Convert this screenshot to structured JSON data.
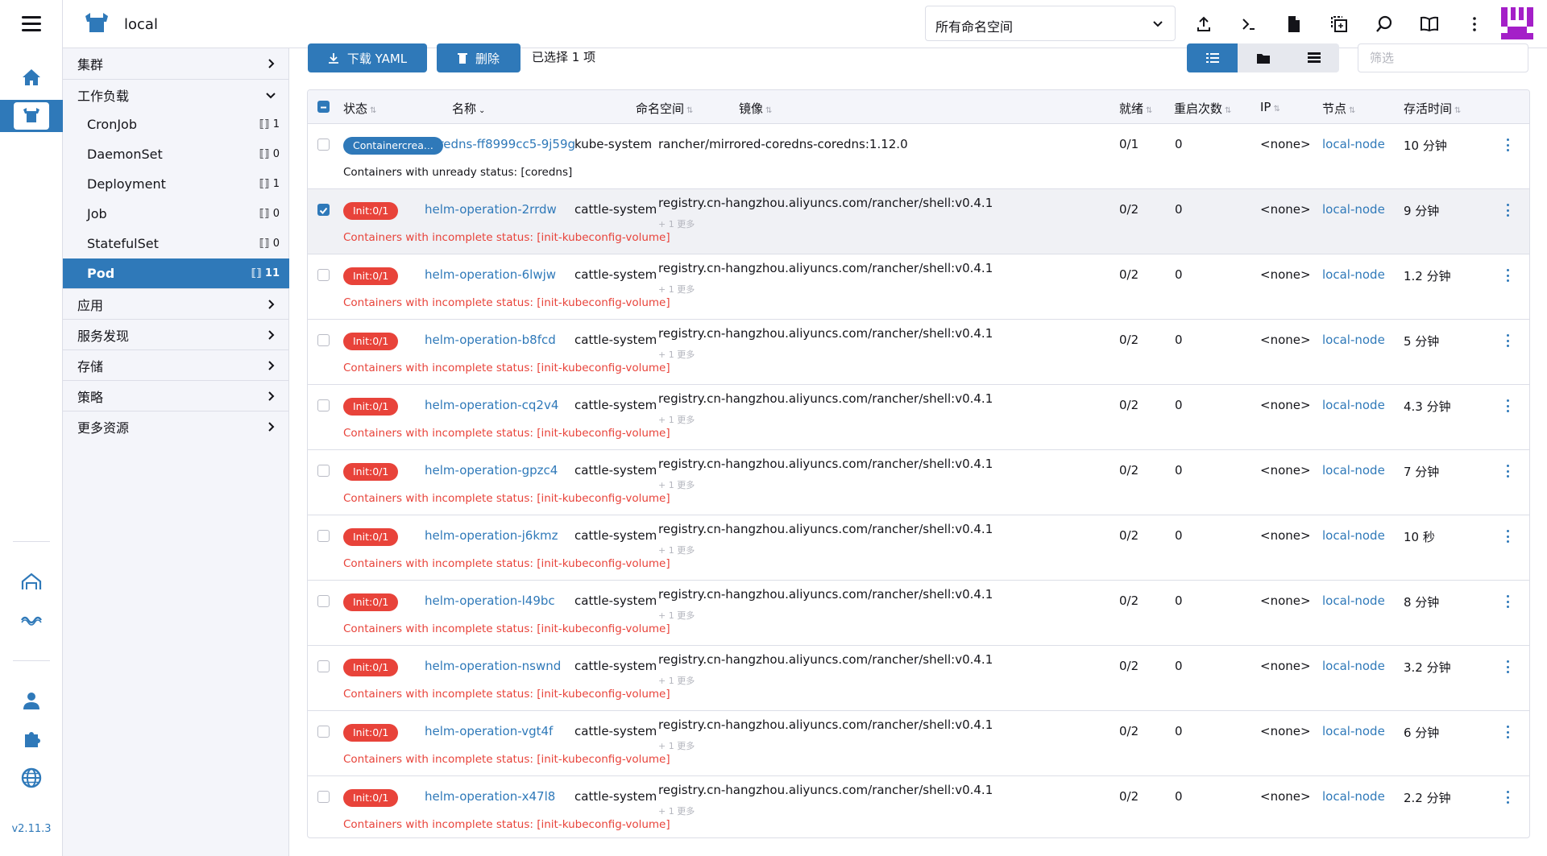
{
  "app": {
    "cluster_name": "local",
    "version": "v2.11.3",
    "colors": {
      "accent": "#2f79b9",
      "error": "#e8433a",
      "sidebar_bg": "#f4f5fa"
    }
  },
  "header": {
    "namespace_select": "所有命名空间",
    "icons": [
      "upload-icon",
      "terminal-icon",
      "file-icon",
      "copy-icon",
      "search-icon",
      "book-icon",
      "more-vertical-icon"
    ]
  },
  "sidebar": {
    "groups_top": [
      {
        "label": "集群"
      },
      {
        "label": "工作负载"
      }
    ],
    "workload_items": [
      {
        "label": "CronJob",
        "count": "1"
      },
      {
        "label": "DaemonSet",
        "count": "0"
      },
      {
        "label": "Deployment",
        "count": "1"
      },
      {
        "label": "Job",
        "count": "0"
      },
      {
        "label": "StatefulSet",
        "count": "0"
      },
      {
        "label": "Pod",
        "count": "11"
      }
    ],
    "groups_bottom": [
      {
        "label": "应用"
      },
      {
        "label": "服务发现"
      },
      {
        "label": "存储"
      },
      {
        "label": "策略"
      },
      {
        "label": "更多资源"
      }
    ]
  },
  "toolbar": {
    "download_yaml": "下载 YAML",
    "delete": "删除",
    "selected_info": "已选择 1 项",
    "filter_placeholder": "筛选"
  },
  "table": {
    "columns": [
      "状态",
      "名称",
      "命名空间",
      "镜像",
      "就绪",
      "重启次数",
      "IP",
      "节点",
      "存活时间"
    ],
    "more_label": "+ 1 更多",
    "rows": [
      {
        "status": "Containercrea...",
        "status_kind": "blue",
        "name": "coredns-ff8999cc5-9j59g",
        "namespace": "kube-system",
        "image": "rancher/mirrored-coredns-coredns:1.12.0",
        "more": "",
        "ready": "0/1",
        "restarts": "0",
        "ip": "<none>",
        "node": "local-node",
        "age": "10 分钟",
        "message": "Containers with unready status: [coredns]",
        "msg_kind": "dark",
        "selected": false
      },
      {
        "status": "Init:0/1",
        "status_kind": "red",
        "name": "helm-operation-2rrdw",
        "namespace": "cattle-system",
        "image": "registry.cn-hangzhou.aliyuncs.com/rancher/shell:v0.4.1",
        "more": "+ 1 更多",
        "ready": "0/2",
        "restarts": "0",
        "ip": "<none>",
        "node": "local-node",
        "age": "9 分钟",
        "message": "Containers with incomplete status: [init-kubeconfig-volume]",
        "msg_kind": "red",
        "selected": true
      },
      {
        "status": "Init:0/1",
        "status_kind": "red",
        "name": "helm-operation-6lwjw",
        "namespace": "cattle-system",
        "image": "registry.cn-hangzhou.aliyuncs.com/rancher/shell:v0.4.1",
        "more": "+ 1 更多",
        "ready": "0/2",
        "restarts": "0",
        "ip": "<none>",
        "node": "local-node",
        "age": "1.2 分钟",
        "message": "Containers with incomplete status: [init-kubeconfig-volume]",
        "msg_kind": "red",
        "selected": false
      },
      {
        "status": "Init:0/1",
        "status_kind": "red",
        "name": "helm-operation-b8fcd",
        "namespace": "cattle-system",
        "image": "registry.cn-hangzhou.aliyuncs.com/rancher/shell:v0.4.1",
        "more": "+ 1 更多",
        "ready": "0/2",
        "restarts": "0",
        "ip": "<none>",
        "node": "local-node",
        "age": "5 分钟",
        "message": "Containers with incomplete status: [init-kubeconfig-volume]",
        "msg_kind": "red",
        "selected": false
      },
      {
        "status": "Init:0/1",
        "status_kind": "red",
        "name": "helm-operation-cq2v4",
        "namespace": "cattle-system",
        "image": "registry.cn-hangzhou.aliyuncs.com/rancher/shell:v0.4.1",
        "more": "+ 1 更多",
        "ready": "0/2",
        "restarts": "0",
        "ip": "<none>",
        "node": "local-node",
        "age": "4.3 分钟",
        "message": "Containers with incomplete status: [init-kubeconfig-volume]",
        "msg_kind": "red",
        "selected": false
      },
      {
        "status": "Init:0/1",
        "status_kind": "red",
        "name": "helm-operation-gpzc4",
        "namespace": "cattle-system",
        "image": "registry.cn-hangzhou.aliyuncs.com/rancher/shell:v0.4.1",
        "more": "+ 1 更多",
        "ready": "0/2",
        "restarts": "0",
        "ip": "<none>",
        "node": "local-node",
        "age": "7 分钟",
        "message": "Containers with incomplete status: [init-kubeconfig-volume]",
        "msg_kind": "red",
        "selected": false
      },
      {
        "status": "Init:0/1",
        "status_kind": "red",
        "name": "helm-operation-j6kmz",
        "namespace": "cattle-system",
        "image": "registry.cn-hangzhou.aliyuncs.com/rancher/shell:v0.4.1",
        "more": "+ 1 更多",
        "ready": "0/2",
        "restarts": "0",
        "ip": "<none>",
        "node": "local-node",
        "age": "10 秒",
        "message": "Containers with incomplete status: [init-kubeconfig-volume]",
        "msg_kind": "red",
        "selected": false
      },
      {
        "status": "Init:0/1",
        "status_kind": "red",
        "name": "helm-operation-l49bc",
        "namespace": "cattle-system",
        "image": "registry.cn-hangzhou.aliyuncs.com/rancher/shell:v0.4.1",
        "more": "+ 1 更多",
        "ready": "0/2",
        "restarts": "0",
        "ip": "<none>",
        "node": "local-node",
        "age": "8 分钟",
        "message": "Containers with incomplete status: [init-kubeconfig-volume]",
        "msg_kind": "red",
        "selected": false
      },
      {
        "status": "Init:0/1",
        "status_kind": "red",
        "name": "helm-operation-nswnd",
        "namespace": "cattle-system",
        "image": "registry.cn-hangzhou.aliyuncs.com/rancher/shell:v0.4.1",
        "more": "+ 1 更多",
        "ready": "0/2",
        "restarts": "0",
        "ip": "<none>",
        "node": "local-node",
        "age": "3.2 分钟",
        "message": "Containers with incomplete status: [init-kubeconfig-volume]",
        "msg_kind": "red",
        "selected": false
      },
      {
        "status": "Init:0/1",
        "status_kind": "red",
        "name": "helm-operation-vgt4f",
        "namespace": "cattle-system",
        "image": "registry.cn-hangzhou.aliyuncs.com/rancher/shell:v0.4.1",
        "more": "+ 1 更多",
        "ready": "0/2",
        "restarts": "0",
        "ip": "<none>",
        "node": "local-node",
        "age": "6 分钟",
        "message": "Containers with incomplete status: [init-kubeconfig-volume]",
        "msg_kind": "red",
        "selected": false
      },
      {
        "status": "Init:0/1",
        "status_kind": "red",
        "name": "helm-operation-x47l8",
        "namespace": "cattle-system",
        "image": "registry.cn-hangzhou.aliyuncs.com/rancher/shell:v0.4.1",
        "more": "+ 1 更多",
        "ready": "0/2",
        "restarts": "0",
        "ip": "<none>",
        "node": "local-node",
        "age": "2.2 分钟",
        "message": "Containers with incomplete status: [init-kubeconfig-volume]",
        "msg_kind": "red",
        "selected": false
      }
    ]
  }
}
